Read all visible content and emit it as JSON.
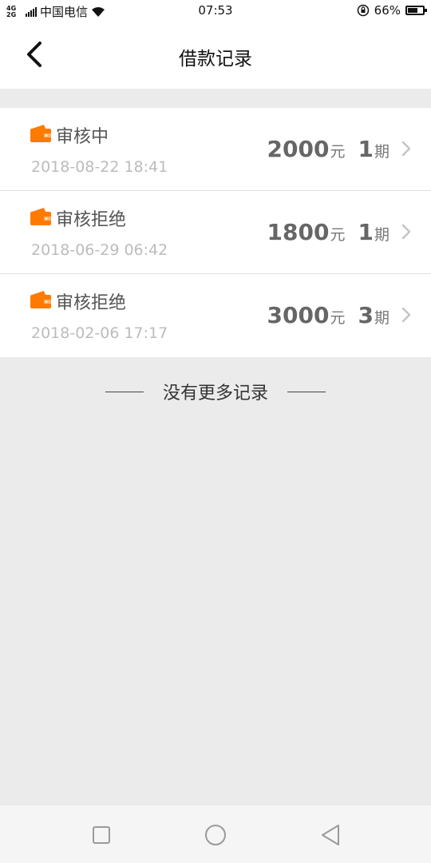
{
  "status_bar": {
    "network": "4G 2G",
    "carrier": "中国电信",
    "time": "07:53",
    "battery": "66%",
    "battery_level": 0.66
  },
  "header": {
    "title": "借款记录",
    "back_icon": "chevron-left-icon"
  },
  "records": [
    {
      "status": "审核中",
      "date": "2018-08-22 18:41",
      "amount": "2000",
      "amount_unit": "元",
      "periods": "1",
      "period_unit": "期"
    },
    {
      "status": "审核拒绝",
      "date": "2018-06-29 06:42",
      "amount": "1800",
      "amount_unit": "元",
      "periods": "1",
      "period_unit": "期"
    },
    {
      "status": "审核拒绝",
      "date": "2018-02-06 17:17",
      "amount": "3000",
      "amount_unit": "元",
      "periods": "3",
      "period_unit": "期"
    }
  ],
  "footer_text": "没有更多记录",
  "colors": {
    "accent": "#ff7a00",
    "background": "#ebebeb"
  }
}
